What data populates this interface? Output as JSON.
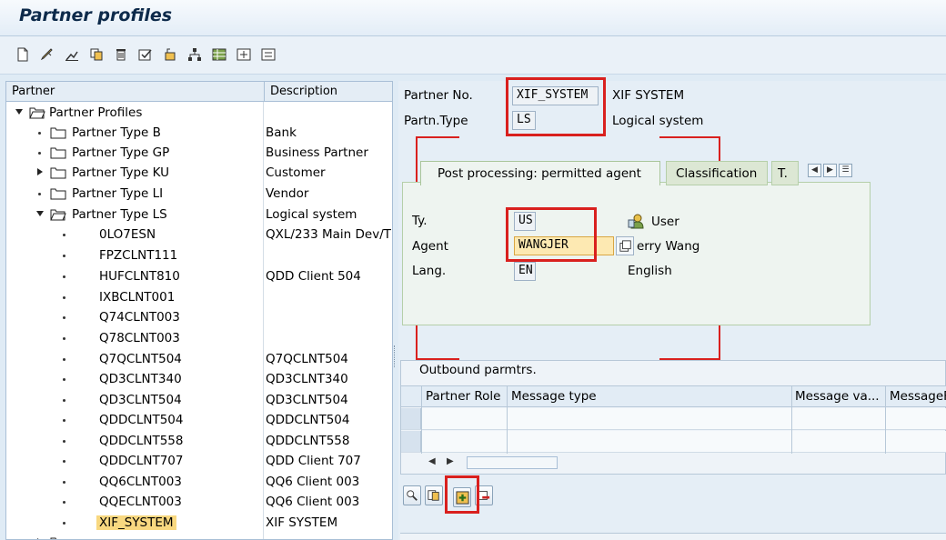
{
  "window": {
    "title": "Partner profiles"
  },
  "toolbar": {
    "icons": [
      "new-icon",
      "edit-icon",
      "display-icon",
      "copy-icon",
      "delete-icon",
      "check-icon",
      "transfer-icon",
      "hierarchy-icon",
      "table-icon",
      "expand-icon",
      "collapse-icon"
    ]
  },
  "tree": {
    "col_partner": "Partner",
    "col_description": "Description",
    "root": "Partner Profiles",
    "groups": [
      {
        "label": "Partner Type B",
        "desc": "Bank"
      },
      {
        "label": "Partner Type GP",
        "desc": "Business Partner"
      },
      {
        "label": "Partner Type KU",
        "desc": "Customer"
      },
      {
        "label": "Partner Type LI",
        "desc": "Vendor"
      },
      {
        "label": "Partner Type LS",
        "desc": "Logical system"
      }
    ],
    "ls_items": [
      {
        "label": "0LO7ESN",
        "desc": "QXL/233 Main Dev/T"
      },
      {
        "label": "FPZCLNT111",
        "desc": ""
      },
      {
        "label": "HUFCLNT810",
        "desc": "QDD Client 504"
      },
      {
        "label": "IXBCLNT001",
        "desc": ""
      },
      {
        "label": "Q74CLNT003",
        "desc": ""
      },
      {
        "label": "Q78CLNT003",
        "desc": ""
      },
      {
        "label": "Q7QCLNT504",
        "desc": "Q7QCLNT504"
      },
      {
        "label": "QD3CLNT340",
        "desc": "QD3CLNT340"
      },
      {
        "label": "QD3CLNT504",
        "desc": "QD3CLNT504"
      },
      {
        "label": "QDDCLNT504",
        "desc": "QDDCLNT504"
      },
      {
        "label": "QDDCLNT558",
        "desc": "QDDCLNT558"
      },
      {
        "label": "QDDCLNT707",
        "desc": "QDD Client 707"
      },
      {
        "label": "QQ6CLNT003",
        "desc": "QQ6 Client 003"
      },
      {
        "label": "QQECLNT003",
        "desc": "QQ6 Client 003"
      },
      {
        "label": "XIF_SYSTEM",
        "desc": "XIF SYSTEM"
      }
    ]
  },
  "header": {
    "partner_no_label": "Partner No.",
    "partner_no_value": "XIF_SYSTEM",
    "partner_no_text": "XIF SYSTEM",
    "partn_type_label": "Partn.Type",
    "partn_type_value": "LS",
    "partn_type_text": "Logical system"
  },
  "tabs": [
    {
      "label": "Post processing: permitted agent"
    },
    {
      "label": "Classification"
    },
    {
      "label": "T."
    }
  ],
  "agent": {
    "ty_label": "Ty.",
    "ty_value": "US",
    "ty_text": "User",
    "agent_label": "Agent",
    "agent_value": "WANGJER",
    "agent_text": "erry Wang",
    "lang_label": "Lang.",
    "lang_value": "EN",
    "lang_text": "English"
  },
  "outbound": {
    "title": "Outbound parmtrs.",
    "columns": [
      "Partner Role",
      "Message type",
      "Message va...",
      "MessageF"
    ]
  },
  "colors": {
    "highlight": "#d9201e",
    "selection": "#f8d880"
  }
}
